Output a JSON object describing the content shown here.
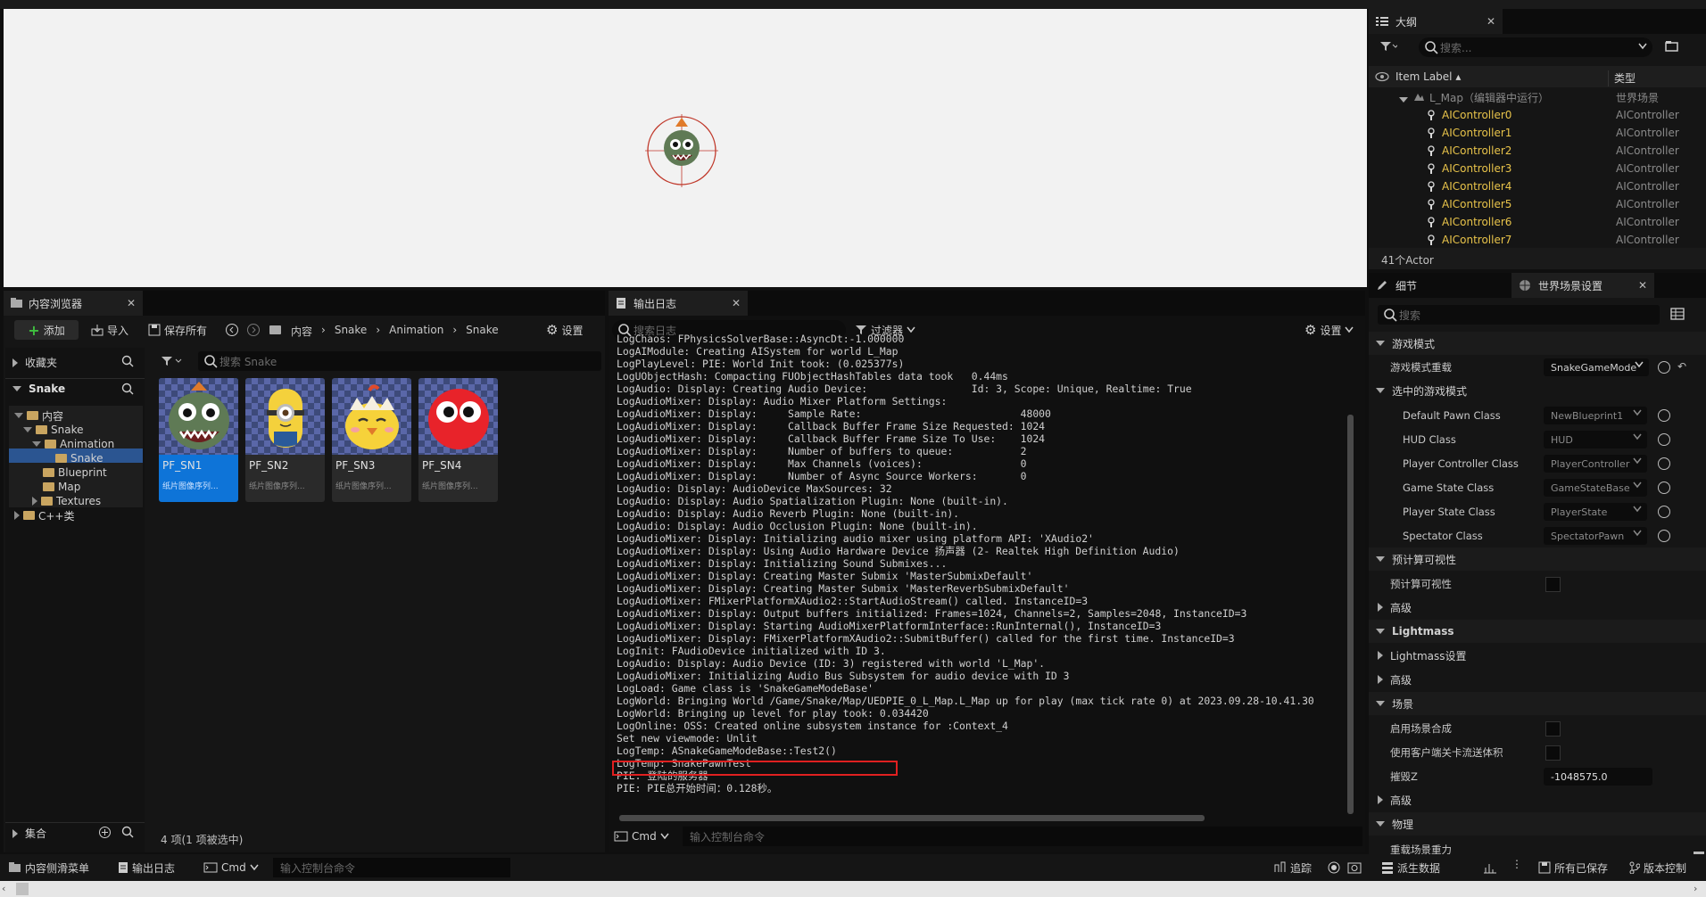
{
  "outliner": {
    "tab_title": "大纲",
    "search_placeholder": "搜索...",
    "col_label": "Item Label",
    "col_type": "类型",
    "root_label": "L_Map（编辑器中运行）",
    "root_type": "世界场景",
    "rows": [
      {
        "label": "AIController0",
        "type": "AIController"
      },
      {
        "label": "AIController1",
        "type": "AIController"
      },
      {
        "label": "AIController2",
        "type": "AIController"
      },
      {
        "label": "AIController3",
        "type": "AIController"
      },
      {
        "label": "AIController4",
        "type": "AIController"
      },
      {
        "label": "AIController5",
        "type": "AIController"
      },
      {
        "label": "AIController6",
        "type": "AIController"
      },
      {
        "label": "AIController7",
        "type": "AIController"
      }
    ],
    "count": "41个Actor"
  },
  "content_browser": {
    "tab_title": "内容浏览器",
    "add": "添加",
    "import": "导入",
    "save_all": "保存所有",
    "breadcrumb": [
      "内容",
      "Snake",
      "Animation",
      "Snake"
    ],
    "settings": "设置",
    "favorites": "收藏夹",
    "project": "Snake",
    "tree": [
      "内容",
      "Snake",
      "Animation",
      "Snake",
      "Blueprint",
      "Map",
      "Textures",
      "C++类"
    ],
    "search_placeholder": "搜索 Snake",
    "items": [
      {
        "name": "PF_SN1",
        "sub": "纸片图像序列..."
      },
      {
        "name": "PF_SN2",
        "sub": "纸片图像序列..."
      },
      {
        "name": "PF_SN3",
        "sub": "纸片图像序列..."
      },
      {
        "name": "PF_SN4",
        "sub": "纸片图像序列..."
      }
    ],
    "collections": "集合",
    "status": "4 项(1 项被选中)"
  },
  "output_log": {
    "tab_title": "输出日志",
    "search_placeholder": "搜索日志",
    "filter": "过滤器",
    "settings": "设置",
    "lines": [
      "LogChaos: FPhysicsSolverBase::AsyncDt:-1.000000",
      "LogAIModule: Creating AISystem for world L_Map",
      "LogPlayLevel: PIE: World Init took: (0.025377s)",
      "LogUObjectHash: Compacting FUObjectHashTables data took   0.44ms",
      "LogAudio: Display: Creating Audio Device:                 Id: 3, Scope: Unique, Realtime: True",
      "LogAudioMixer: Display: Audio Mixer Platform Settings:",
      "LogAudioMixer: Display:     Sample Rate:                          48000",
      "LogAudioMixer: Display:     Callback Buffer Frame Size Requested: 1024",
      "LogAudioMixer: Display:     Callback Buffer Frame Size To Use:    1024",
      "LogAudioMixer: Display:     Number of buffers to queue:           2",
      "LogAudioMixer: Display:     Max Channels (voices):                0",
      "LogAudioMixer: Display:     Number of Async Source Workers:       0",
      "LogAudio: Display: AudioDevice MaxSources: 32",
      "LogAudio: Display: Audio Spatialization Plugin: None (built-in).",
      "LogAudio: Display: Audio Reverb Plugin: None (built-in).",
      "LogAudio: Display: Audio Occlusion Plugin: None (built-in).",
      "LogAudioMixer: Display: Initializing audio mixer using platform API: 'XAudio2'",
      "LogAudioMixer: Display: Using Audio Hardware Device 扬声器 (2- Realtek High Definition Audio)",
      "LogAudioMixer: Display: Initializing Sound Submixes...",
      "LogAudioMixer: Display: Creating Master Submix 'MasterSubmixDefault'",
      "LogAudioMixer: Display: Creating Master Submix 'MasterReverbSubmixDefault'",
      "LogAudioMixer: FMixerPlatformXAudio2::StartAudioStream() called. InstanceID=3",
      "LogAudioMixer: Display: Output buffers initialized: Frames=1024, Channels=2, Samples=2048, InstanceID=3",
      "LogAudioMixer: Display: Starting AudioMixerPlatformInterface::RunInternal(), InstanceID=3",
      "LogAudioMixer: Display: FMixerPlatformXAudio2::SubmitBuffer() called for the first time. InstanceID=3",
      "LogInit: FAudioDevice initialized with ID 3.",
      "LogAudio: Display: Audio Device (ID: 3) registered with world 'L_Map'.",
      "LogAudioMixer: Initializing Audio Bus Subsystem for audio device with ID 3",
      "LogLoad: Game class is 'SnakeGameModeBase'",
      "LogWorld: Bringing World /Game/Snake/Map/UEDPIE_0_L_Map.L_Map up for play (max tick rate 0) at 2023.09.28-10.41.30",
      "LogWorld: Bringing up level for play took: 0.034420",
      "LogOnline: OSS: Created online subsystem instance for :Context_4",
      "Set new viewmode: Unlit",
      "LogTemp: ASnakeGameModeBase::Test2()",
      "LogTemp: SnakePawnTest",
      "PIE: 登陆的服务器",
      "PIE: PIE总开始时间：0.128秒。"
    ],
    "cmd": "Cmd",
    "console_placeholder": "输入控制台命令"
  },
  "details": {
    "tab_details": "细节",
    "tab_world": "世界场景设置",
    "search_placeholder": "搜索",
    "sections": {
      "game_mode": "游戏模式",
      "selected_game_mode": "选中的游戏模式",
      "precomputed": "预计算可视性",
      "advanced1": "高级",
      "lightmass": "Lightmass",
      "lightmass_settings": "Lightmass设置",
      "advanced2": "高级",
      "scene": "场景",
      "advanced3": "高级",
      "physics": "物理"
    },
    "game_mode_override_label": "游戏模式重载",
    "game_mode_override_value": "SnakeGameMode",
    "class_rows": [
      {
        "label": "Default Pawn Class",
        "value": "NewBlueprint1"
      },
      {
        "label": "HUD Class",
        "value": "HUD"
      },
      {
        "label": "Player Controller Class",
        "value": "PlayerController"
      },
      {
        "label": "Game State Class",
        "value": "GameStateBase"
      },
      {
        "label": "Player State Class",
        "value": "PlayerState"
      },
      {
        "label": "Spectator Class",
        "value": "SpectatorPawn"
      }
    ],
    "precomputed_label": "预计算可视性",
    "enable_compose": "启用场景合成",
    "client_stream": "使用客户端关卡流送体积",
    "kill_z_label": "摧毁Z",
    "kill_z_value": "-1048575.0",
    "physics_row": "重载场景重力"
  },
  "statusbar": {
    "drawer": "内容侧滑菜单",
    "output_log": "输出日志",
    "cmd": "Cmd",
    "console_placeholder": "输入控制台命令",
    "trace": "追踪",
    "derived_data": "派生数据",
    "all_saved": "所有已保存",
    "source_control": "版本控制"
  },
  "colors": {
    "accent": "#0e74d8",
    "highlight_box": "#e02020",
    "outliner_label": "#e8c34a"
  }
}
